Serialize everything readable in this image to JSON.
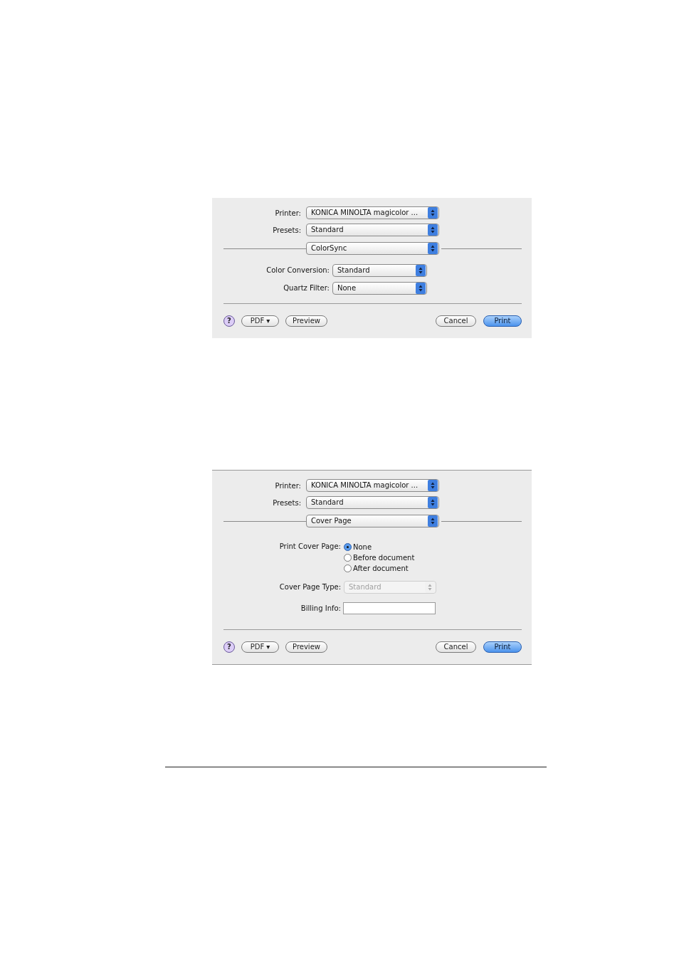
{
  "dialogs": [
    {
      "printer": {
        "label": "Printer:",
        "value": "KONICA MINOLTA magicolor ..."
      },
      "presets": {
        "label": "Presets:",
        "value": "Standard"
      },
      "panel": "ColorSync",
      "fields": [
        {
          "kind": "popup",
          "label": "Color Conversion:",
          "value": "Standard",
          "disabled": false
        },
        {
          "kind": "popup",
          "label": "Quartz Filter:",
          "value": "None",
          "disabled": false
        }
      ],
      "footer": {
        "help": "?",
        "pdf": "PDF ▾",
        "preview": "Preview",
        "cancel": "Cancel",
        "print": "Print"
      }
    },
    {
      "printer": {
        "label": "Printer:",
        "value": "KONICA MINOLTA magicolor ..."
      },
      "presets": {
        "label": "Presets:",
        "value": "Standard"
      },
      "panel": "Cover Page",
      "fields": [
        {
          "kind": "radio",
          "label": "Print Cover Page:",
          "options": [
            {
              "label": "None",
              "selected": true
            },
            {
              "label": "Before document",
              "selected": false
            },
            {
              "label": "After document",
              "selected": false
            }
          ]
        },
        {
          "kind": "popup",
          "label": "Cover Page Type:",
          "value": "Standard",
          "disabled": true
        },
        {
          "kind": "input",
          "label": "Billing Info:"
        }
      ],
      "footer": {
        "help": "?",
        "pdf": "PDF ▾",
        "preview": "Preview",
        "cancel": "Cancel",
        "print": "Print"
      }
    }
  ]
}
